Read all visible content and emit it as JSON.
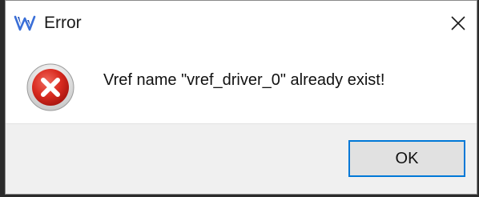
{
  "window": {
    "title": "Error",
    "app_icon": "gowin-logo-icon",
    "close_icon": "close-icon"
  },
  "dialog": {
    "icon": "error-icon",
    "message": "Vref name \"vref_driver_0\" already exist!",
    "ok_label": "OK"
  },
  "colors": {
    "accent": "#0078d7",
    "error_red": "#d32f2f",
    "footer_bg": "#f0f0f0"
  }
}
